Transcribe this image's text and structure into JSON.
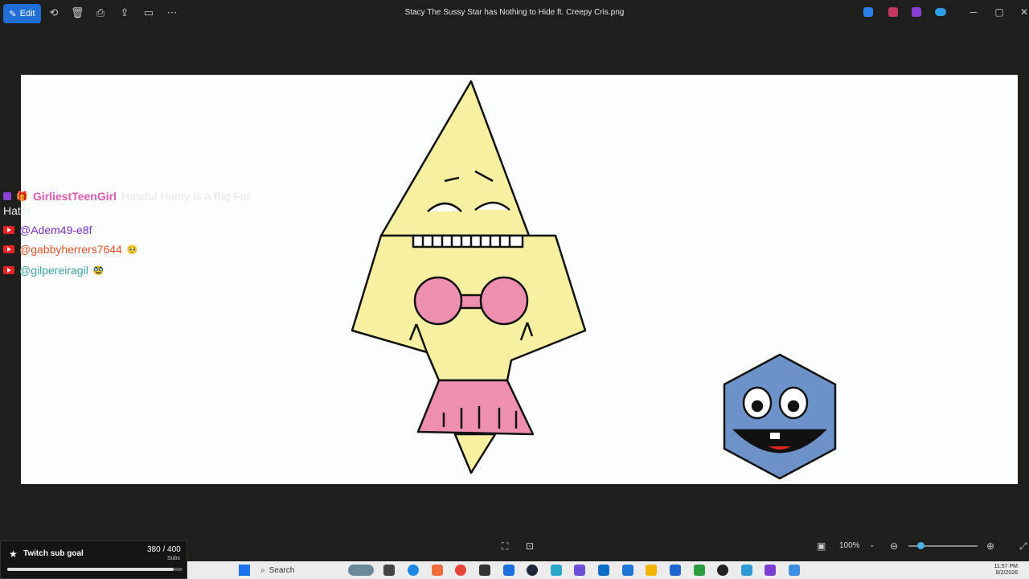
{
  "titlebar": {
    "edit_label": "Edit",
    "title": "Stacy The Sussy Star has Nothing to Hide ft. Creepy Cris.png",
    "icons": [
      "rotate-icon",
      "delete-icon",
      "print-icon",
      "share-icon",
      "slideshow-icon",
      "more-icon"
    ]
  },
  "chat": {
    "top_user": "GirliestTeenGirl",
    "top_message": "Hateful Henry is A Big Fat",
    "top_message_cont": "Hater",
    "messages": [
      {
        "user": "@Adem49-e8f",
        "color": "#7a2fc4",
        "emoji": ""
      },
      {
        "user": "@gabbyherrers7644",
        "color": "#e2532a",
        "emoji": "🥺"
      },
      {
        "user": "@gilpereiragil",
        "color": "#3fa3a0",
        "emoji": "🥸"
      }
    ]
  },
  "zoom": {
    "value": "100%"
  },
  "subgoal": {
    "label": "Twitch sub goal",
    "count": "380 / 400",
    "unit": "Subs",
    "progress": 0.95
  },
  "taskbar": {
    "search_placeholder": "Search",
    "time": "11:57 PM",
    "date": "8/2/2026"
  }
}
